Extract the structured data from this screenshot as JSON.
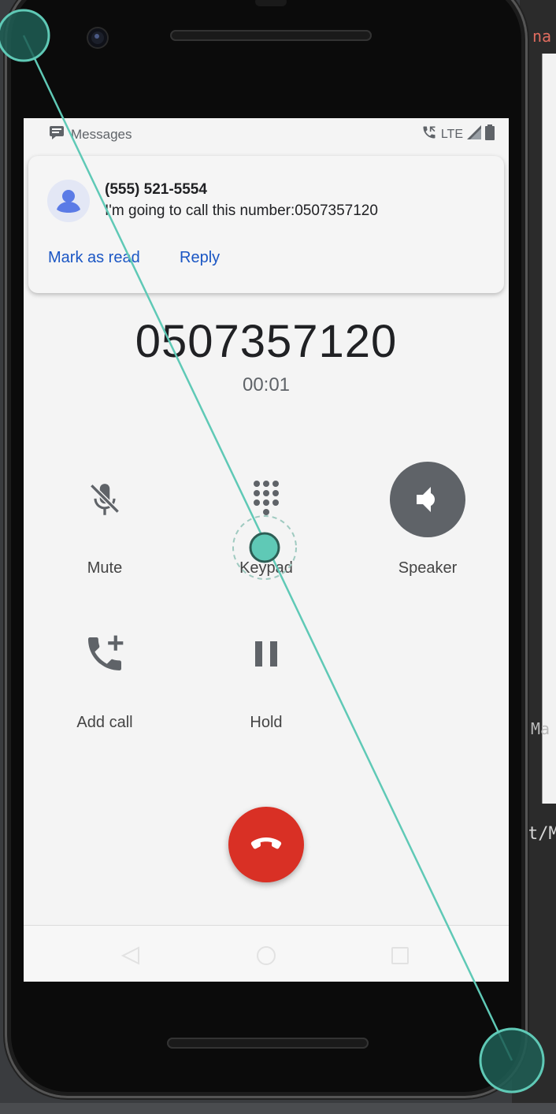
{
  "background": {
    "top_right_fragment": "na",
    "mid_right_fragment": "Ma",
    "code_fragment": "t/M"
  },
  "status_bar": {
    "app_name": "Messages",
    "network": "LTE"
  },
  "notification": {
    "sender": "(555) 521-5554",
    "message": "I'm going to call this number:0507357120",
    "actions": [
      "Mark as read",
      "Reply"
    ]
  },
  "call": {
    "number": "0507357120",
    "duration": "00:01"
  },
  "controls": {
    "mute": "Mute",
    "keypad": "Keypad",
    "speaker": "Speaker",
    "add_call": "Add call",
    "hold": "Hold"
  },
  "colors": {
    "accent_link": "#1a56c4",
    "end_call": "#d93025",
    "touch_indicator": "#5fc9b6",
    "speaker_active": "#5f6368"
  },
  "icons": [
    "messages-icon",
    "phone-call-icon",
    "signal-icon",
    "battery-icon",
    "contact-avatar-icon",
    "mic-off-icon",
    "dialpad-icon",
    "volume-icon",
    "add-call-icon",
    "pause-icon",
    "call-end-icon",
    "back-icon",
    "home-icon",
    "recents-icon"
  ]
}
